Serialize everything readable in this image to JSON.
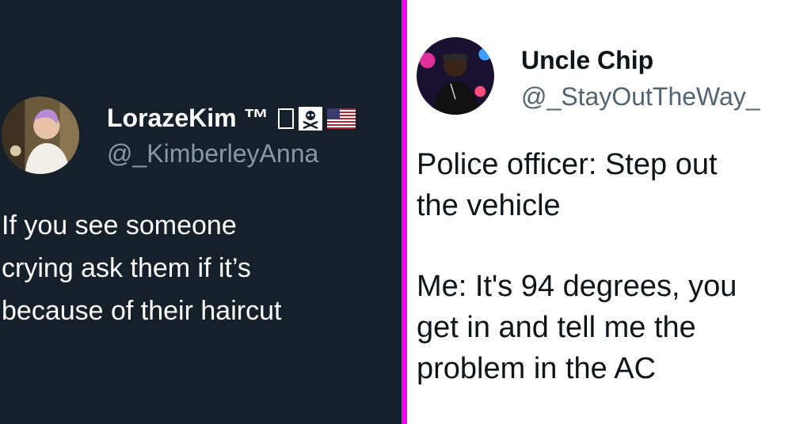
{
  "colors": {
    "left_background": "#15202b",
    "divider": "#ff00ff",
    "right_background": "#ffffff",
    "left_handle": "#8899a6",
    "right_handle": "#536471"
  },
  "left_tweet": {
    "display_name": "LorazeKim ™",
    "badges": [
      "box-icon",
      "skull-crossbones-icon",
      "us-flag-icon"
    ],
    "handle": "@_KimberleyAnna",
    "text": "If you see someone\ncrying ask them if it’s\nbecause of their haircut"
  },
  "right_tweet": {
    "display_name": "Uncle Chip",
    "handle": "@_StayOutTheWay_",
    "text_paragraph_1": "Police officer: Step out\nthe vehicle",
    "text_paragraph_2": "Me: It's 94 degrees, you\nget in and tell me the\nproblem in the AC"
  }
}
